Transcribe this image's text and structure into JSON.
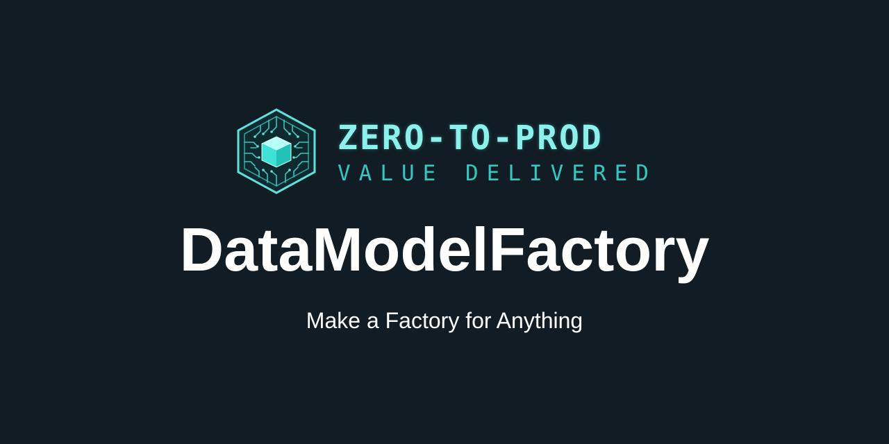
{
  "brand": {
    "name": "ZERO-TO-PROD",
    "tagline": "VALUE DELIVERED",
    "logo_icon": "circuit-hexagon-cube-icon",
    "accent_color": "#8ef0ea",
    "tagline_color": "#33c7c0"
  },
  "hero": {
    "title": "DataModelFactory",
    "subtitle": "Make a Factory for Anything"
  },
  "colors": {
    "background": "#111c25",
    "text": "#ffffff"
  }
}
